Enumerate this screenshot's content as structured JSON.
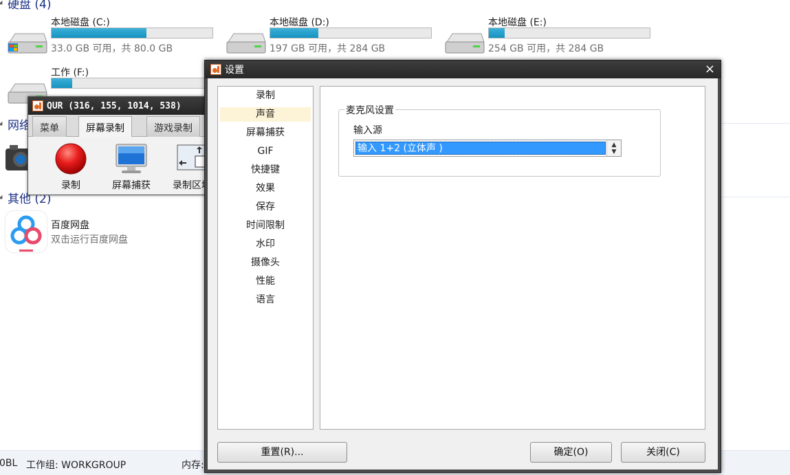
{
  "explorer": {
    "drives_group": "硬盘 (4)",
    "network_group": "网络",
    "other_group": "其他 (2)",
    "drives": [
      {
        "name": "本地磁盘 (C:)",
        "size_text": "33.0 GB 可用，共 80.0 GB",
        "used_fraction": 0.59
      },
      {
        "name": "本地磁盘 (D:)",
        "size_text": "197 GB 可用，共 284 GB",
        "used_fraction": 0.3
      },
      {
        "name": "本地磁盘 (E:)",
        "size_text": "254 GB 可用，共 284 GB",
        "used_fraction": 0.1
      },
      {
        "name": "工作 (F:)",
        "size_text": "",
        "used_fraction": 0.13
      }
    ],
    "app": {
      "name": "百度网盘",
      "description": "双击运行百度网盘"
    },
    "status": {
      "computer": "0BL",
      "workgroup": "工作组: WORKGROUP",
      "memory": "内存:"
    }
  },
  "qur": {
    "title": "QUR (316, 155, 1014, 538)",
    "tabs": [
      "菜单",
      "屏幕录制",
      "游戏录制"
    ],
    "active_tab": 1,
    "tools": [
      {
        "label": "录制",
        "icon": "record-icon"
      },
      {
        "label": "屏幕捕获",
        "icon": "monitor-icon"
      },
      {
        "label": "录制区域",
        "icon": "region-icon"
      }
    ]
  },
  "settings": {
    "title": "设置",
    "close_glyph": "×",
    "nav": [
      "录制",
      "声音",
      "屏幕捕获",
      "GIF",
      "快捷键",
      "效果",
      "保存",
      "时间限制",
      "水印",
      "摄像头",
      "性能",
      "语言"
    ],
    "selected_nav": 1,
    "mic_group_title": "麦克风设置",
    "input_source_label": "输入源",
    "input_source_value": "输入 1+2 (立体声 )",
    "buttons": {
      "reset": "重置(R)...",
      "ok": "确定(O)",
      "close": "关闭(C)"
    }
  },
  "colors": {
    "accent": "#3399ff",
    "selected_nav_bg": "#fdf3d6",
    "drive_bar": "#1692c0",
    "link_blue": "#1e3287"
  }
}
